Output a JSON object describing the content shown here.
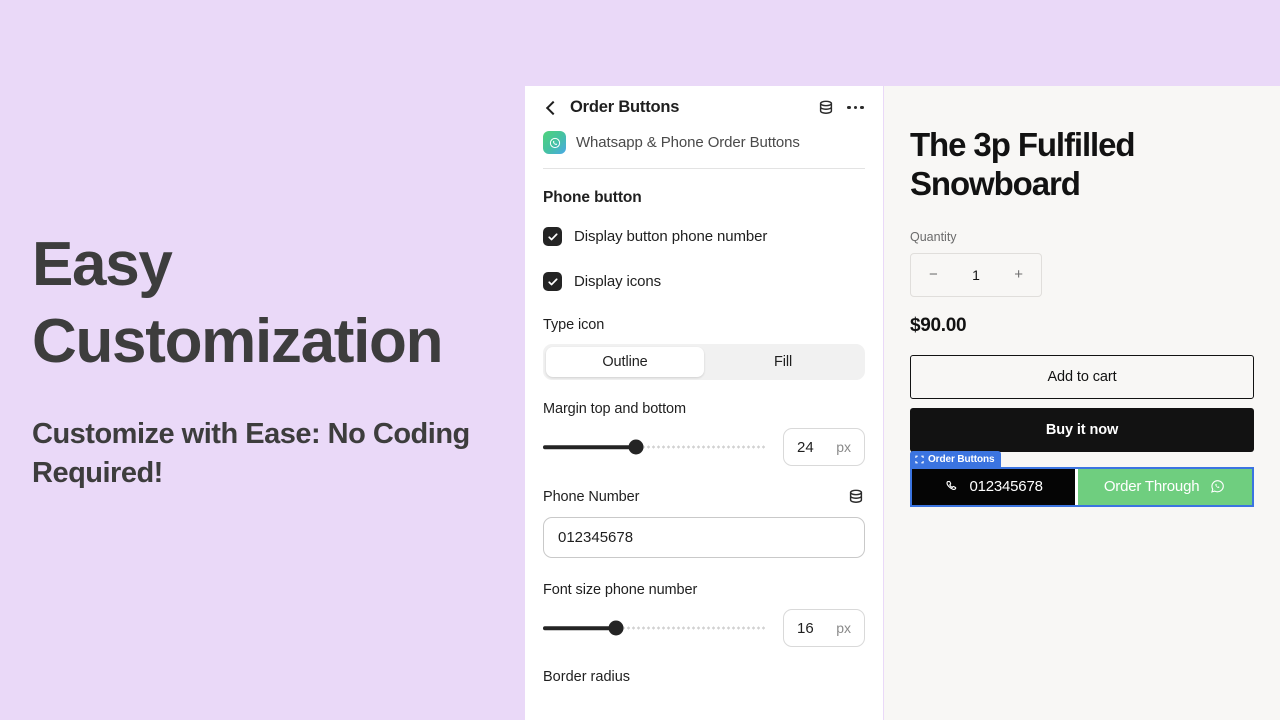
{
  "promo": {
    "headline": "Easy Customization",
    "subheadline": "Customize with Ease: No Coding Required!"
  },
  "settings": {
    "header": {
      "back_icon": "chevron-left-icon",
      "title": "Order Buttons",
      "database_icon": "database-icon",
      "more_icon": "ellipsis-icon"
    },
    "app": {
      "icon": "whatsapp-app-icon",
      "name": "Whatsapp & Phone Order Buttons"
    },
    "section_title": "Phone button",
    "checkboxes": [
      {
        "label": "Display button phone number",
        "checked": true
      },
      {
        "label": "Display icons",
        "checked": true
      }
    ],
    "type_icon": {
      "label": "Type icon",
      "options": [
        "Outline",
        "Fill"
      ],
      "selected": "Outline"
    },
    "margin": {
      "label": "Margin top and bottom",
      "value": "24",
      "unit": "px",
      "percent": 42
    },
    "phone_number": {
      "label": "Phone Number",
      "database_icon": "database-icon",
      "value": "012345678"
    },
    "font_size": {
      "label": "Font size phone number",
      "value": "16",
      "unit": "px",
      "percent": 33
    },
    "next_label": "Border radius"
  },
  "preview": {
    "product_title": "The 3p Fulfilled Snowboard",
    "quantity_label": "Quantity",
    "quantity": {
      "minus": "−",
      "value": "1",
      "plus": "+"
    },
    "price": "$90.00",
    "add_to_cart": "Add to cart",
    "buy_it_now": "Buy it now",
    "block_badge": {
      "icon": "block-select-icon",
      "label": "Order Buttons"
    },
    "phone_button": {
      "icon": "phone-icon",
      "label": "012345678"
    },
    "whatsapp_button": {
      "label": "Order Through",
      "icon": "whatsapp-icon"
    }
  },
  "colors": {
    "background": "#ead9f8",
    "accent_blue": "#3b74e0",
    "whatsapp_green": "#6fce7f",
    "dark": "#121212"
  }
}
